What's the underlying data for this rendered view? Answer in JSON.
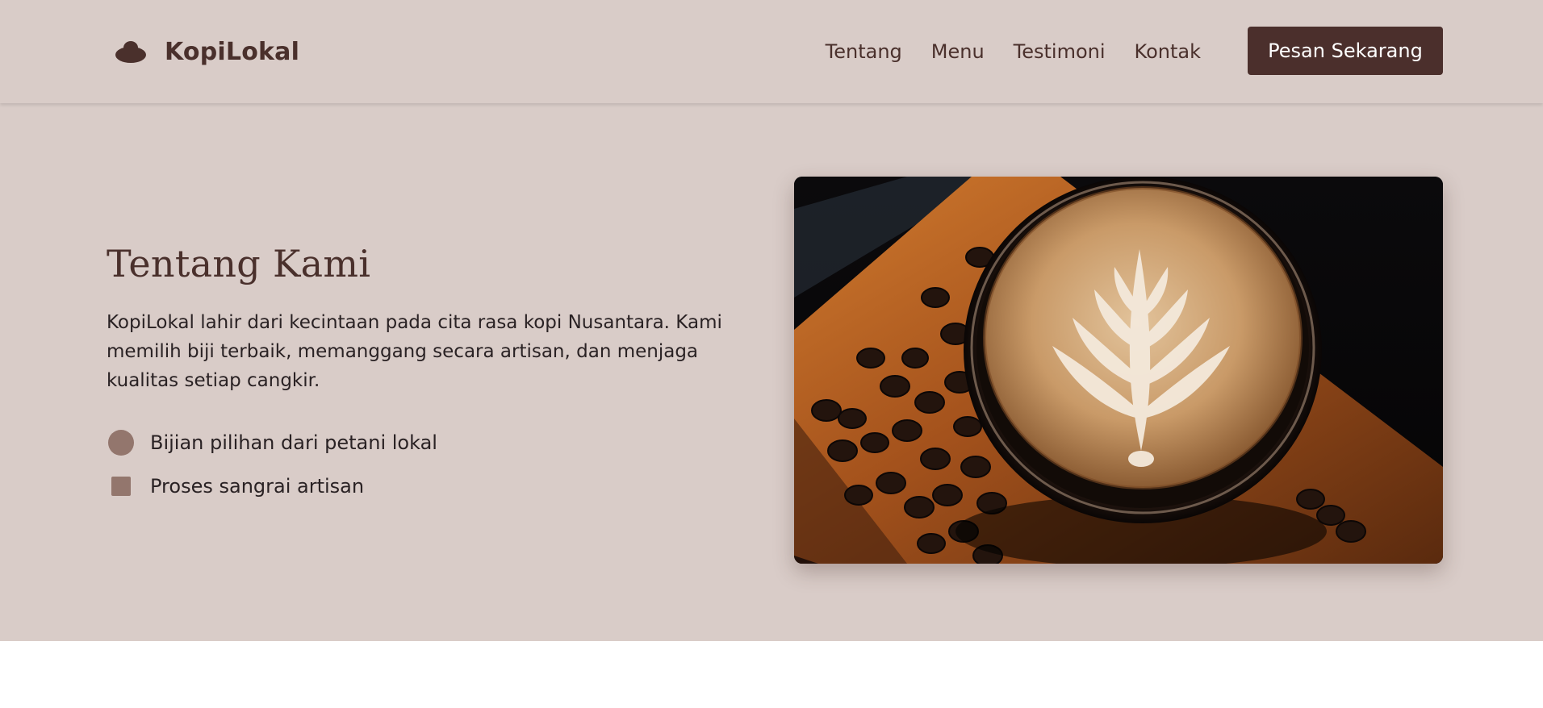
{
  "brand": {
    "name": "KopiLokal",
    "icon": "coffee-bean-icon"
  },
  "nav": {
    "links": [
      "Tentang",
      "Menu",
      "Testimoni",
      "Kontak"
    ],
    "cta_label": "Pesan Sekarang"
  },
  "about": {
    "title": "Tentang Kami",
    "description": "KopiLokal lahir dari kecintaan pada cita rasa kopi Nusantara. Kami memilih biji terbaik, memanggang secara artisan, dan menjaga kualitas setiap cangkir.",
    "features": [
      {
        "label": "Bijian pilihan dari petani lokal",
        "icon": "circle-icon"
      },
      {
        "label": "Proses sangrai artisan",
        "icon": "square-icon"
      }
    ]
  },
  "colors": {
    "background": "#d9ccc8",
    "accent": "#4b2f2c",
    "bullet": "#93766d"
  }
}
